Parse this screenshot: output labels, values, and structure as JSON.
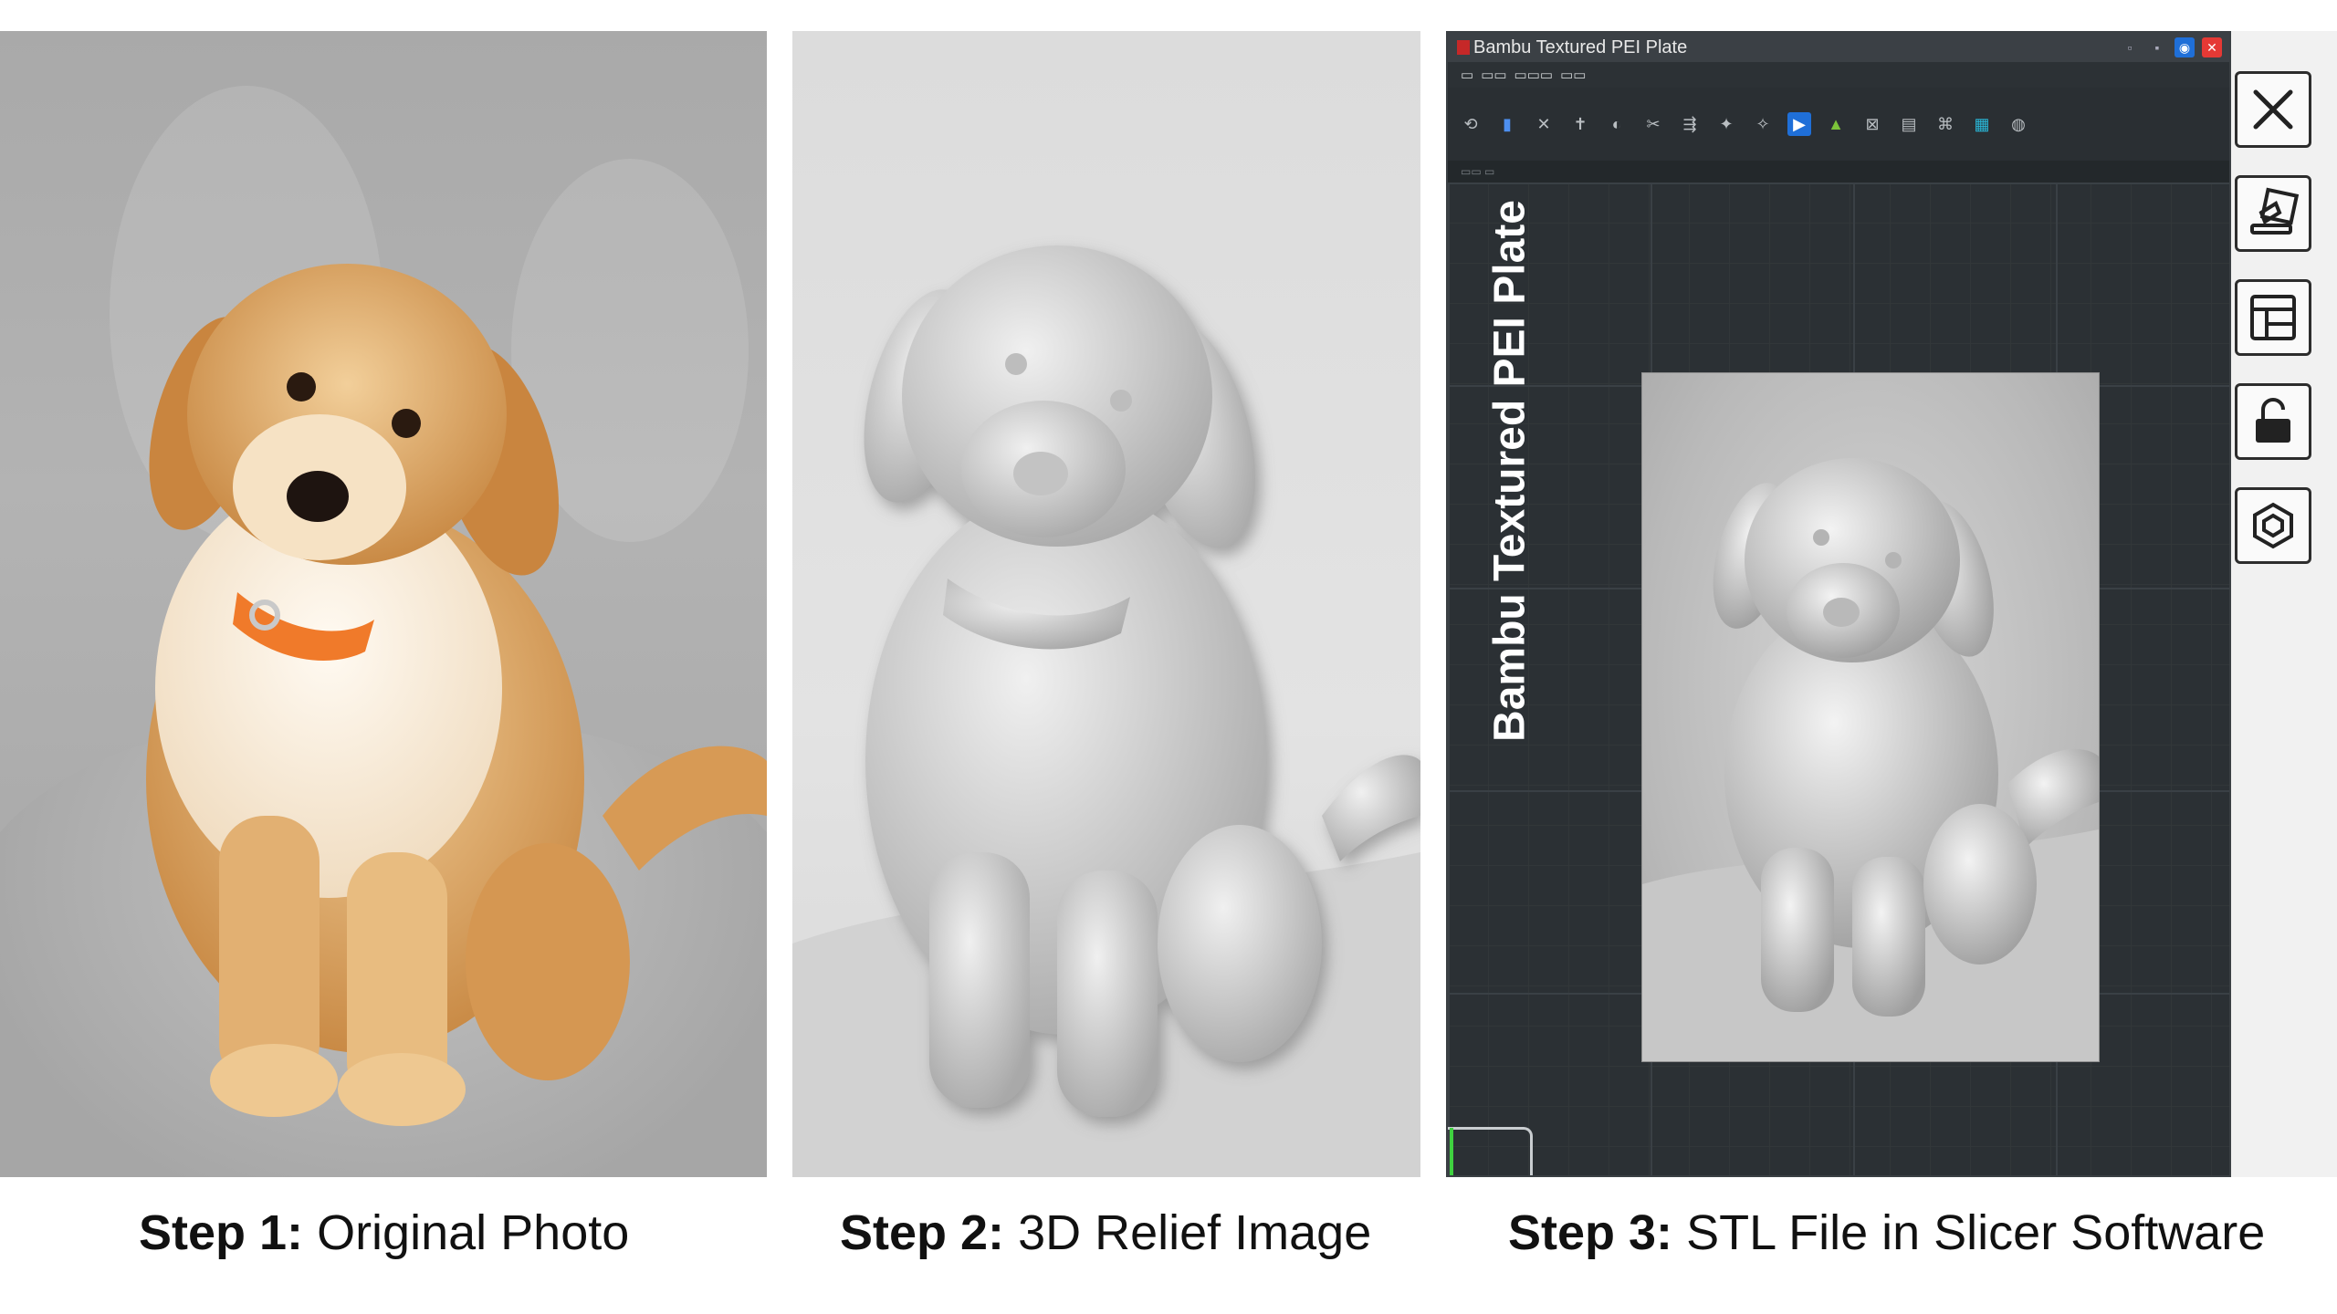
{
  "captions": [
    {
      "step": "Step 1:",
      "text": "Original Photo"
    },
    {
      "step": "Step 2:",
      "text": "3D Relief Image"
    },
    {
      "step": "Step 3:",
      "text": "STL File in Slicer Software"
    }
  ],
  "slicer": {
    "window_title": "Bambu Textured PEI Plate",
    "plate_label": "Bambu Textured PEI Plate"
  },
  "sidebar": {
    "buttons": [
      {
        "name": "close-icon"
      },
      {
        "name": "edit-canvas-icon"
      },
      {
        "name": "layout-icon"
      },
      {
        "name": "unlock-icon"
      },
      {
        "name": "hexagon-settings-icon"
      }
    ]
  },
  "colors": {
    "puppy_fur": "#d9a25e",
    "collar": "#f07a2a",
    "slicer_bg": "#2b3034",
    "accent_blue": "#1f6fd8",
    "accent_red": "#e53935"
  }
}
